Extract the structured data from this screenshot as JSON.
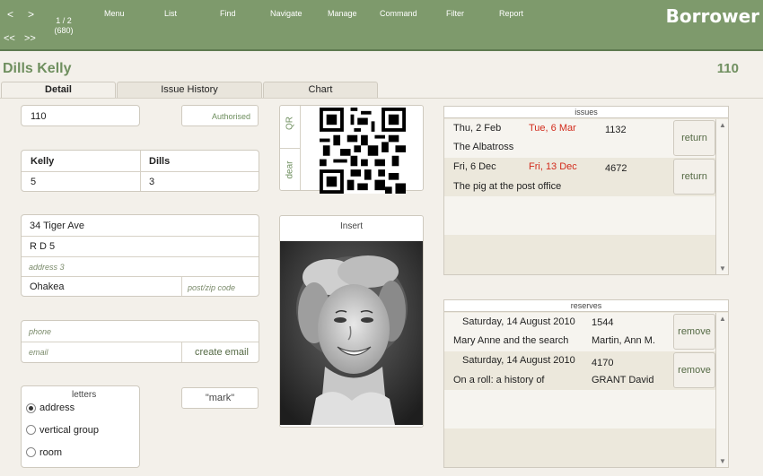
{
  "toolbar": {
    "prev": "<",
    "next": ">",
    "first": "<<",
    "last": ">>",
    "record_pos": "1 / 2",
    "record_total": "(680)",
    "menu": [
      "Menu",
      "List",
      "Find",
      "Navigate",
      "Manage",
      "Command",
      "Filter",
      "Report"
    ],
    "layout_title": "Borrower"
  },
  "header": {
    "name": "Dills Kelly",
    "id": "110"
  },
  "tabs": [
    {
      "label": "Detail",
      "active": true
    },
    {
      "label": "Issue History",
      "active": false
    },
    {
      "label": "Chart",
      "active": false
    }
  ],
  "detail": {
    "borrower_id": "110",
    "authorised_label": "Authorised",
    "first_name": "Kelly",
    "last_name": "Dills",
    "first_val": "5",
    "last_val": "3",
    "address1": "34 Tiger Ave",
    "address2": "R D 5",
    "address3_placeholder": "address 3",
    "city": "Ohakea",
    "postcode_placeholder": "post/zip code",
    "phone_placeholder": "phone",
    "email_placeholder": "email",
    "create_email": "create email",
    "letters_label": "letters",
    "letters_options": [
      "address",
      "vertical group",
      "room"
    ],
    "letters_selected": "address",
    "mark_button": "\"mark\""
  },
  "media": {
    "qr_label": "QR",
    "dear_label": "dear",
    "insert_label": "Insert"
  },
  "issues": {
    "title": "issues",
    "rows": [
      {
        "issued": "Thu, 2 Feb",
        "due": "Tue, 6 Mar",
        "number": "1132",
        "title": "The Albatross",
        "action": "return"
      },
      {
        "issued": "Fri, 6 Dec",
        "due": "Fri, 13 Dec",
        "number": "4672",
        "title": "The pig at the post office",
        "action": "return"
      }
    ]
  },
  "reserves": {
    "title": "reserves",
    "rows": [
      {
        "date": "Saturday, 14 August 2010",
        "number": "1544",
        "title": "Mary Anne and the search",
        "author": "Martin, Ann M.",
        "action": "remove"
      },
      {
        "date": "Saturday, 14 August 2010",
        "number": "4170",
        "title": "On a roll: a history of",
        "author": "GRANT  David",
        "action": "remove"
      }
    ]
  },
  "colors": {
    "toolbar": "#7e9a6c",
    "accent": "#6f8f5f",
    "due_red": "#d22b1c"
  }
}
